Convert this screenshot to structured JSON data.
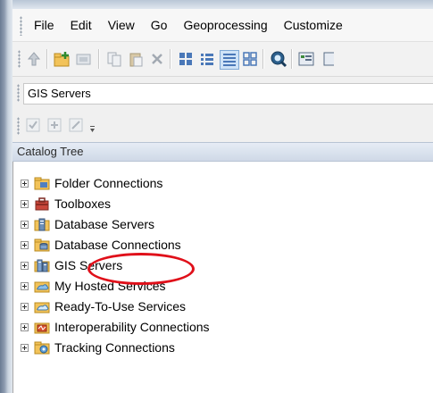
{
  "menubar": {
    "items": [
      "File",
      "Edit",
      "View",
      "Go",
      "Geoprocessing",
      "Customize"
    ]
  },
  "toolbar1": {
    "icons": [
      "up-folder-icon",
      "connect-folder-icon",
      "disconnect-icon",
      "copy-icon",
      "paste-icon",
      "delete-icon",
      "large-icons-icon",
      "list-icon",
      "details-icon",
      "thumbnails-icon",
      "search-icon",
      "catalog-window-icon"
    ]
  },
  "location": {
    "value": "GIS Servers"
  },
  "toolbar2": {
    "icons": [
      "check-icon",
      "add-icon",
      "edit-icon",
      "overflow-icon"
    ]
  },
  "tree": {
    "header": "Catalog Tree",
    "items": [
      {
        "label": "Folder Connections",
        "icon": "folder-icon"
      },
      {
        "label": "Toolboxes",
        "icon": "toolbox-icon"
      },
      {
        "label": "Database Servers",
        "icon": "database-server-icon"
      },
      {
        "label": "Database Connections",
        "icon": "database-connection-icon"
      },
      {
        "label": "GIS Servers",
        "icon": "gis-server-icon"
      },
      {
        "label": "My Hosted Services",
        "icon": "hosted-services-icon"
      },
      {
        "label": "Ready-To-Use Services",
        "icon": "ready-to-use-services-icon"
      },
      {
        "label": "Interoperability Connections",
        "icon": "interoperability-icon"
      },
      {
        "label": "Tracking Connections",
        "icon": "tracking-icon"
      }
    ]
  },
  "colors": {
    "annotation": "#e0101a",
    "header_bg": "#d8e1ee",
    "folder": "#f2c35a"
  }
}
